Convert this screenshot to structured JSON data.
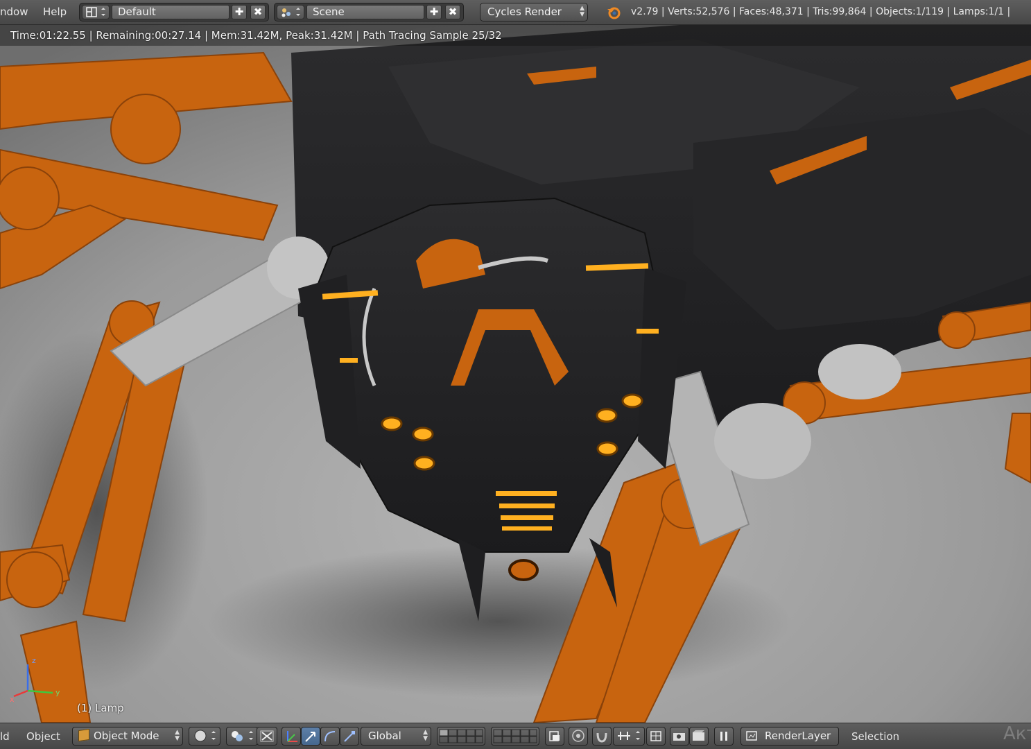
{
  "top_header": {
    "menu": [
      "ndow",
      "Help"
    ],
    "screen_layout": "Default",
    "scene": "Scene",
    "render_engine": "Cycles Render",
    "stats": "v2.79 | Verts:52,576 | Faces:48,371 | Tris:99,864 | Objects:1/119 | Lamps:1/1 |"
  },
  "viewport": {
    "render_info": "Time:01:22.55 | Remaining:00:27.14 | Mem:31.42M, Peak:31.42M | Path Tracing Sample 25/32",
    "active_object": "(1) Lamp",
    "gizmo_axes": [
      "z",
      "y",
      "x"
    ]
  },
  "bottom_header": {
    "menu": [
      "ld",
      "Object"
    ],
    "mode": "Object Mode",
    "orientation": "Global",
    "render_layer": "RenderLayer",
    "selection_label": "Selection",
    "watermark": "Акт"
  },
  "colors": {
    "accent_orange": "#c8640f",
    "body_black": "#232325",
    "header_bg": "#505050",
    "glow": "#ffb020"
  }
}
